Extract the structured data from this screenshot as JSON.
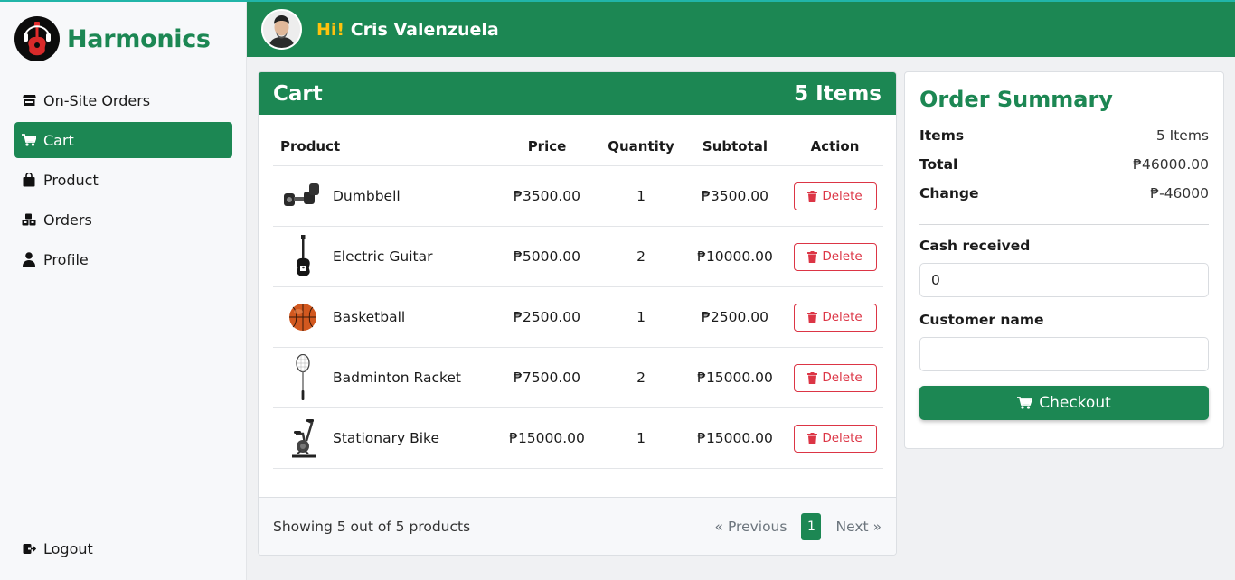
{
  "brand": {
    "name": "Harmonics"
  },
  "sidebar": {
    "items": [
      {
        "label": "On-Site Orders",
        "icon": "store-icon"
      },
      {
        "label": "Cart",
        "icon": "cart-icon",
        "active": true
      },
      {
        "label": "Product",
        "icon": "bag-icon"
      },
      {
        "label": "Orders",
        "icon": "boxes-icon"
      },
      {
        "label": "Profile",
        "icon": "user-icon"
      }
    ],
    "logout_label": "Logout"
  },
  "header": {
    "hi": "Hi!",
    "user_name": "Cris Valenzuela"
  },
  "cart": {
    "title": "Cart",
    "count_label": "5 Items",
    "columns": {
      "product": "Product",
      "price": "Price",
      "quantity": "Quantity",
      "subtotal": "Subtotal",
      "action": "Action"
    },
    "rows": [
      {
        "name": "Dumbbell",
        "price": "₱3500.00",
        "qty": "1",
        "subtotal": "₱3500.00",
        "action": "Delete",
        "thumb": "dumbbell-image"
      },
      {
        "name": "Electric Guitar",
        "price": "₱5000.00",
        "qty": "2",
        "subtotal": "₱10000.00",
        "action": "Delete",
        "thumb": "guitar-image"
      },
      {
        "name": "Basketball",
        "price": "₱2500.00",
        "qty": "1",
        "subtotal": "₱2500.00",
        "action": "Delete",
        "thumb": "basketball-image"
      },
      {
        "name": "Badminton Racket",
        "price": "₱7500.00",
        "qty": "2",
        "subtotal": "₱15000.00",
        "action": "Delete",
        "thumb": "racket-image"
      },
      {
        "name": "Stationary Bike",
        "price": "₱15000.00",
        "qty": "1",
        "subtotal": "₱15000.00",
        "action": "Delete",
        "thumb": "bike-image"
      }
    ],
    "footer_text": "Showing 5 out of 5 products",
    "pagination": {
      "previous": "« Previous",
      "current": "1",
      "next": "Next »"
    }
  },
  "summary": {
    "title": "Order Summary",
    "items_label": "Items",
    "items_value": "5 Items",
    "total_label": "Total",
    "total_value": "₱46000.00",
    "change_label": "Change",
    "change_value": "₱-46000",
    "cash_label": "Cash received",
    "cash_value": "0",
    "customer_label": "Customer name",
    "customer_value": "",
    "checkout_label": "Checkout"
  },
  "colors": {
    "brand": "#1c8753",
    "accent": "#ffc20e",
    "danger": "#dc3545"
  }
}
